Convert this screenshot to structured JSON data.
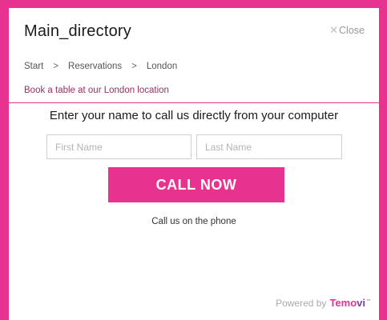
{
  "header": {
    "title": "Main_directory",
    "close_label": "Close",
    "close_glyph": "✕"
  },
  "breadcrumb": {
    "items": [
      "Start",
      "Reservations",
      "London"
    ],
    "separator": ">"
  },
  "subtitle": "Book a table at our London location",
  "form": {
    "prompt": "Enter your name to call us directly from your computer",
    "first_name_placeholder": "First Name",
    "last_name_placeholder": "Last Name",
    "call_button_label": "CALL NOW",
    "phone_text": "Call us on the phone"
  },
  "footer": {
    "powered_by": "Powered by",
    "brand_part1": "Temo",
    "brand_part2": "vi",
    "brand_tm": "™"
  },
  "colors": {
    "accent": "#e8328f",
    "brand_purple": "#7b3fb0",
    "subtitle_text": "#9b2f63"
  },
  "icons": {
    "close": "close-icon"
  }
}
